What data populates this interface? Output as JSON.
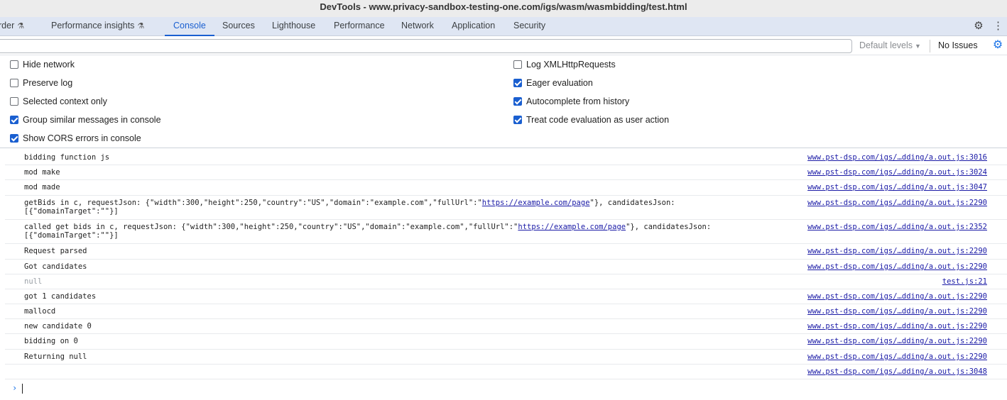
{
  "window": {
    "title": "DevTools - www.privacy-sandbox-testing-one.com/igs/wasm/wasmbidding/test.html"
  },
  "tabs": [
    {
      "label": "rder",
      "experimental": true
    },
    {
      "label": "Performance insights",
      "experimental": true
    },
    {
      "label": "Console",
      "active": true
    },
    {
      "label": "Sources"
    },
    {
      "label": "Lighthouse"
    },
    {
      "label": "Performance"
    },
    {
      "label": "Network"
    },
    {
      "label": "Application"
    },
    {
      "label": "Security"
    }
  ],
  "toolbar_icons": {
    "settings": "gear-icon",
    "menu": "kebab-menu-icon"
  },
  "filter": {
    "value": "",
    "levels_label": "Default levels",
    "issues_label": "No Issues"
  },
  "settings": {
    "left": [
      {
        "label": "Hide network",
        "checked": false
      },
      {
        "label": "Preserve log",
        "checked": false
      },
      {
        "label": "Selected context only",
        "checked": false
      },
      {
        "label": "Group similar messages in console",
        "checked": true
      },
      {
        "label": "Show CORS errors in console",
        "checked": true
      }
    ],
    "right": [
      {
        "label": "Log XMLHttpRequests",
        "checked": false
      },
      {
        "label": "Eager evaluation",
        "checked": true
      },
      {
        "label": "Autocomplete from history",
        "checked": true
      },
      {
        "label": "Treat code evaluation as user action",
        "checked": true
      }
    ]
  },
  "console": {
    "messages": [
      {
        "text": "bidding function js",
        "source": "www.pst-dsp.com/igs/…dding/a.out.js:3016"
      },
      {
        "text": "mod make",
        "source": "www.pst-dsp.com/igs/…dding/a.out.js:3024"
      },
      {
        "text": "mod made",
        "source": "www.pst-dsp.com/igs/…dding/a.out.js:3047"
      },
      {
        "text_before": "getBids in c, requestJson: {\"width\":300,\"height\":250,\"country\":\"US\",\"domain\":\"example.com\",\"fullUrl\":\"",
        "link": "https://example.com/page",
        "text_after": "\"}, candidatesJson:\n[{\"domainTarget\":\"\"}]",
        "source": "www.pst-dsp.com/igs/…dding/a.out.js:2290"
      },
      {
        "text_before": "called get bids in c, requestJson: {\"width\":300,\"height\":250,\"country\":\"US\",\"domain\":\"example.com\",\"fullUrl\":\"",
        "link": "https://example.com/page",
        "text_after": "\"}, candidatesJson:\n[{\"domainTarget\":\"\"}]",
        "source": "www.pst-dsp.com/igs/…dding/a.out.js:2352"
      },
      {
        "text": "Request parsed",
        "source": "www.pst-dsp.com/igs/…dding/a.out.js:2290"
      },
      {
        "text": "Got candidates",
        "source": "www.pst-dsp.com/igs/…dding/a.out.js:2290"
      },
      {
        "text": "null",
        "source": "test.js:21",
        "muted": true
      },
      {
        "text": "got 1 candidates",
        "source": "www.pst-dsp.com/igs/…dding/a.out.js:2290"
      },
      {
        "text": "mallocd",
        "source": "www.pst-dsp.com/igs/…dding/a.out.js:2290"
      },
      {
        "text": "new candidate 0",
        "source": "www.pst-dsp.com/igs/…dding/a.out.js:2290"
      },
      {
        "text": "bidding on 0",
        "source": "www.pst-dsp.com/igs/…dding/a.out.js:2290"
      },
      {
        "text": "Returning null",
        "source": "www.pst-dsp.com/igs/…dding/a.out.js:2290"
      },
      {
        "text": "",
        "source": "www.pst-dsp.com/igs/…dding/a.out.js:3048"
      }
    ],
    "prompt_icon": "chevron-right-icon"
  }
}
